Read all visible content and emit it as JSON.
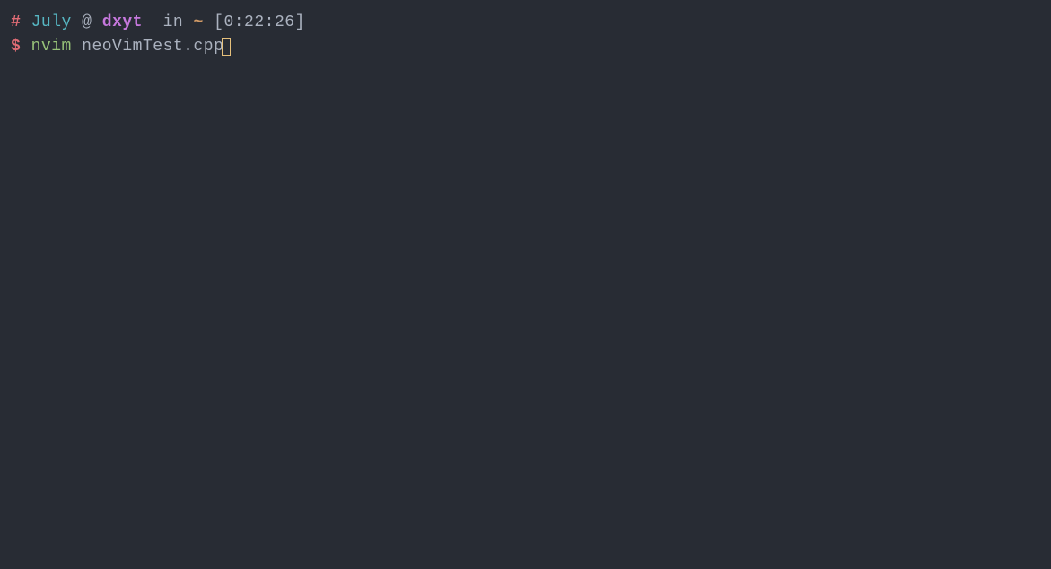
{
  "prompt_line1": {
    "hash": "#",
    "user": "July",
    "at": "@",
    "host": "dxyt",
    "in_text": "in",
    "tilde": "~",
    "time": "[0:22:26]"
  },
  "prompt_line2": {
    "dollar": "$",
    "command": "nvim",
    "filename": "neoVimTest.cpp"
  }
}
